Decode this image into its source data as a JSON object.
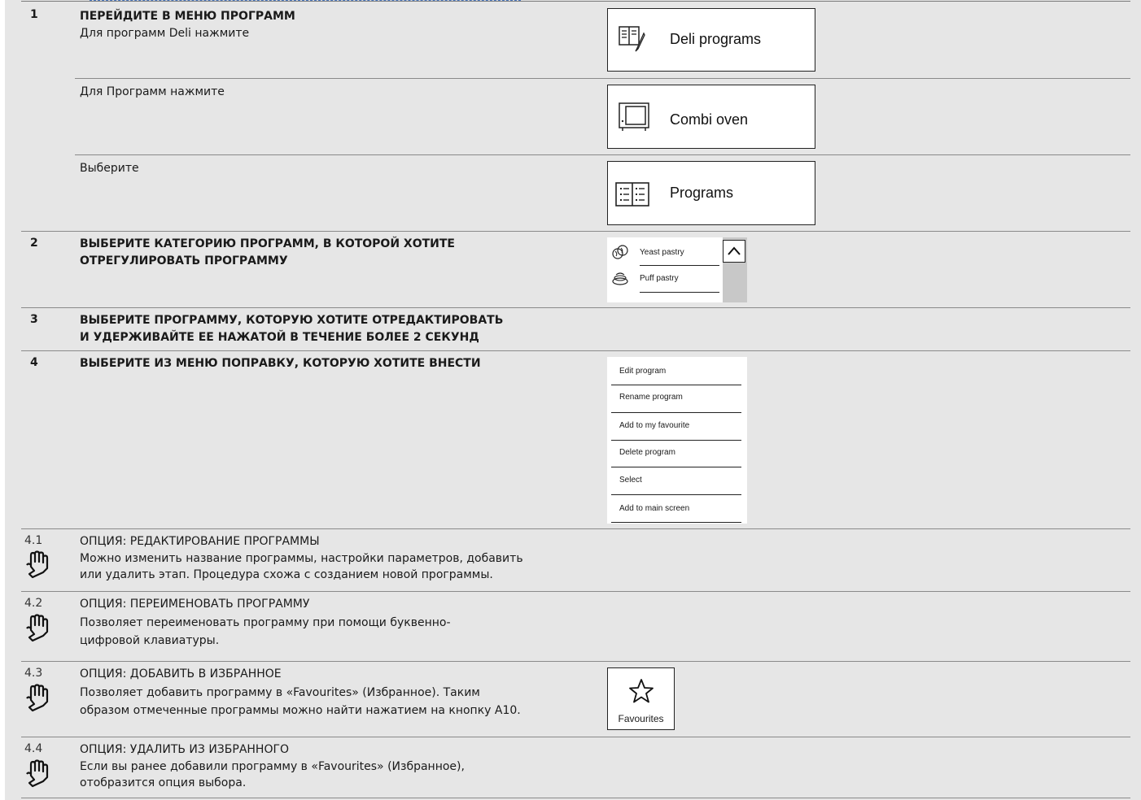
{
  "steps": {
    "s1": {
      "num": "1",
      "title": "ПЕРЕЙДИТЕ В МЕНЮ ПРОГРАММ",
      "line_a": "Для программ Deli нажмите",
      "line_b": "Для Программ нажмите",
      "line_c": "Выберите"
    },
    "s2": {
      "num": "2",
      "title_1": "ВЫБЕРИТЕ КАТЕГОРИЮ ПРОГРАММ, В КОТОРОЙ ХОТИТЕ",
      "title_2": "ОТРЕГУЛИРОВАТЬ ПРОГРАММУ"
    },
    "s3": {
      "num": "3",
      "title_1": "ВЫБЕРИТЕ ПРОГРАММУ, КОТОРУЮ ХОТИТЕ ОТРЕДАКТИРОВАТЬ",
      "title_2": "И УДЕРЖИВАЙТЕ ЕЕ НАЖАТОЙ В ТЕЧЕНИЕ БОЛЕЕ 2 СЕКУНД"
    },
    "s4": {
      "num": "4",
      "title": "ВЫБЕРИТЕ ИЗ МЕНЮ ПОПРАВКУ, КОТОРУЮ ХОТИТЕ ВНЕСТИ"
    },
    "s41": {
      "num": "4.1",
      "title": "ОПЦИЯ: РЕДАКТИРОВАНИЕ ПРОГРАММЫ",
      "body_1": "Можно изменить название программы, настройки параметров, добавить",
      "body_2": "или удалить этап. Процедура схожа с созданием новой программы."
    },
    "s42": {
      "num": "4.2",
      "title": "ОПЦИЯ: ПЕРЕИМЕНОВАТЬ ПРОГРАММУ",
      "body_1": "Позволяет переименовать программу при помощи буквенно-",
      "body_2": "цифровой клавиатуры."
    },
    "s43": {
      "num": "4.3",
      "title": "ОПЦИЯ: ДОБАВИТЬ В ИЗБРАННОЕ",
      "body_1": "Позволяет добавить программу в «Favourites» (Избранное). Таким",
      "body_2": "образом отмеченные программы можно найти нажатием на кнопку A10."
    },
    "s44": {
      "num": "4.4",
      "title": "ОПЦИЯ: УДАЛИТЬ ИЗ ИЗБРАННОГО",
      "body_1": "Если вы ранее добавили программу в «Favourites» (Избранное),",
      "body_2": "отобразится опция выбора."
    }
  },
  "ui": {
    "deli_button": {
      "label": "Deli programs",
      "icon": "deli-book-icon"
    },
    "combi_button": {
      "label": "Combi oven",
      "icon": "oven-icon"
    },
    "programs_button": {
      "label": "Programs",
      "icon": "programs-book-icon"
    },
    "categories": [
      {
        "label": "Yeast pastry",
        "icon": "yeast-pastry-icon"
      },
      {
        "label": "Puff pastry",
        "icon": "puff-pastry-icon"
      }
    ],
    "scroll_up_icon": "chevron-up-icon",
    "menu_items": [
      "Edit program",
      "Rename program",
      "Add to my favourite",
      "Delete program",
      "Select",
      "Add to main screen"
    ],
    "favourites": {
      "label": "Favourites",
      "icon": "star-icon"
    },
    "hand_icon": "pointing-hand-icon"
  }
}
